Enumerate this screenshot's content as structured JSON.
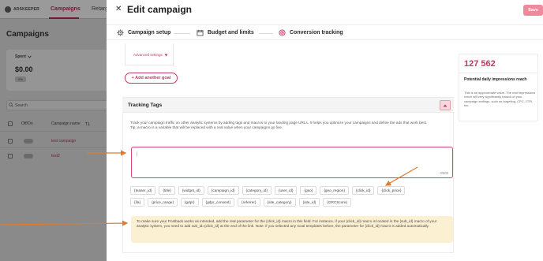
{
  "background_app": {
    "logo_text": "ADSKEEPER",
    "nav_tabs": [
      "Campaigns",
      "Retarg"
    ],
    "page_heading": "Campaigns",
    "spent_label": "Spent",
    "spent_value": "$0.00",
    "spent_pct": "0%",
    "search_placeholder": "Search",
    "table_headers": [
      "Off/On",
      "Campaign name"
    ],
    "rows": [
      {
        "name": "test campaign"
      },
      {
        "name": "test2"
      }
    ]
  },
  "modal": {
    "title": "Edit campaign",
    "save_label": "Save",
    "steps": [
      {
        "label": "Campaign setup",
        "icon": "gear-icon"
      },
      {
        "label": "Budget and limits",
        "icon": "calendar-icon"
      },
      {
        "label": "Conversion tracking",
        "icon": "target-icon"
      }
    ],
    "advanced_settings_label": "Advanced settings",
    "add_goal_label": "+ Add another goal",
    "tracking_tags": {
      "title": "Tracking Tags",
      "description": "Track your campaign traffic on other analytic systems by adding tags and macros to your landing page URLs. It helps you optimize your campaigns and define the ads that work best.",
      "tip": "Tip: a macro is a variable that will be replaced with a real value when your campaigns go live.",
      "input_value": "",
      "counter": "0/600",
      "macros_row1": [
        "{teaser_id}",
        "{title}",
        "{widget_id}",
        "{campaign_id}",
        "{category_id}",
        "{user_id}",
        "{geo}",
        "{geo_region}",
        "{click_id}",
        "{click_price}"
      ],
      "macros_row2": [
        "{ifa}",
        "{price_range}",
        "{gdpr}",
        "{gdpr_consent}",
        "{referrer}",
        "{site_category}",
        "{site_id}",
        "{GRCScore}"
      ],
      "note": "To make sure your Postback works as intended, add the real parameter for the {click_id} macro in this field. For instance, if your {click_id} macro is located in the {sub_id} macro of your analytic system, you need to add sub_id={click_id} at the end of the link. Note: if you selected any Goal templates before, the parameter for {click_id} macro is added automatically."
    }
  },
  "reach": {
    "value": "127 562",
    "title": "Potential daily impressions reach",
    "description": "This is an approximate value. The real impressions reach will very significantly based on your campaign settings, such as targeting, CPC, CTR, etc."
  },
  "colors": {
    "accent": "#c2395e",
    "save_button": "#ef8a9b",
    "note_bg": "#fcf0d2",
    "arrow": "#e07a2e"
  }
}
